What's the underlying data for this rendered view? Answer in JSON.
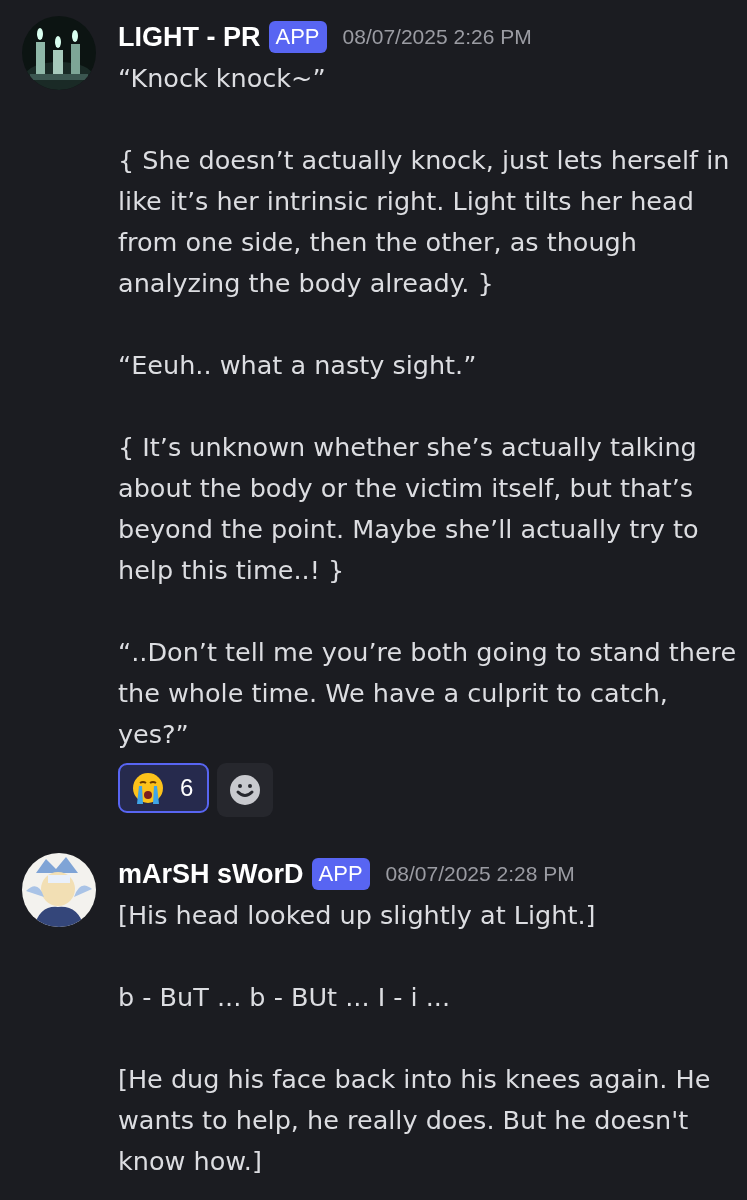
{
  "messages": [
    {
      "author": "LIGHT - PR",
      "badge": "APP",
      "timestamp": "08/07/2025 2:26 PM",
      "avatar": {
        "kind": "picture"
      },
      "paragraphs": [
        "“Knock knock~”",
        "{ She doesn’t actually knock, just lets herself in like it’s her intrinsic right. Light tilts her head from one side, then the other, as though analyzing the body already. }",
        "“Eeuh.. what a nasty sight.”",
        "{ It’s unknown whether she’s actually talking about the body or the victim itself, but that’s beyond the point. Maybe she’ll actually try to help this time..! }",
        "“..Don’t tell me you’re both going to stand there the whole time. We have a culprit to catch, yes?”"
      ],
      "reactions": [
        {
          "count": "6",
          "selected": true
        }
      ]
    },
    {
      "author": "mArSH sWorD",
      "badge": "APP",
      "timestamp": "08/07/2025 2:28 PM",
      "avatar": {
        "kind": "picture"
      },
      "paragraphs": [
        "[His head looked up slightly at Light.]",
        "b - BuT ... b - BUt ... I - i ...",
        "[He dug his face back into his knees again. He wants to help, he really does. But he doesn't know how.]"
      ]
    }
  ]
}
